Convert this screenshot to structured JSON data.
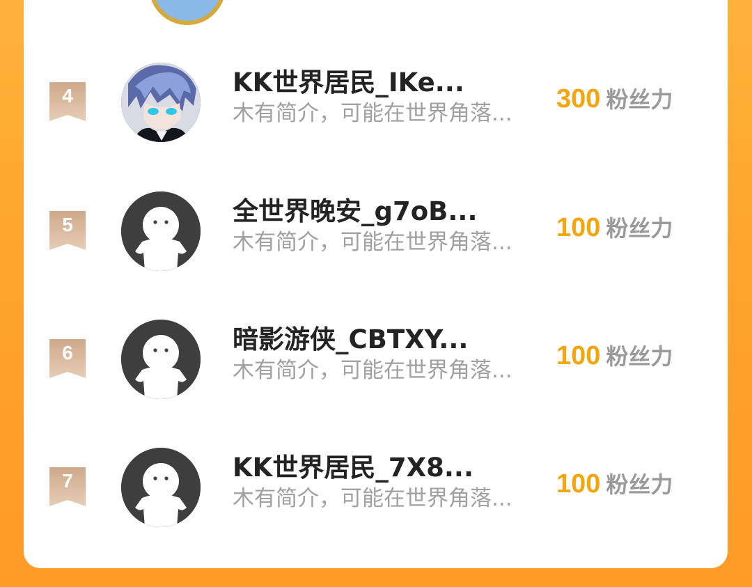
{
  "leaderboard": {
    "rows": [
      {
        "rank": "4",
        "name": "KK世界居民_IKe...",
        "bio": "木有简介，可能在世界角落...",
        "fans": "300",
        "fans_unit": "粉丝力",
        "avatar": "anime-character"
      },
      {
        "rank": "5",
        "name": "全世界晚安_g7oB...",
        "bio": "木有简介，可能在世界角落...",
        "fans": "100",
        "fans_unit": "粉丝力",
        "avatar": "default-user"
      },
      {
        "rank": "6",
        "name": "暗影游侠_CBTXY...",
        "bio": "木有简介，可能在世界角落...",
        "fans": "100",
        "fans_unit": "粉丝力",
        "avatar": "default-user"
      },
      {
        "rank": "7",
        "name": "KK世界居民_7X8...",
        "bio": "木有简介，可能在世界角落...",
        "fans": "100",
        "fans_unit": "粉丝力",
        "avatar": "default-user"
      }
    ]
  },
  "colors": {
    "background": "#ffa42e",
    "rank_badge": "#d8b99c",
    "fans_number": "#f4a60c",
    "name": "#232323",
    "bio": "#a0a0a0",
    "fans_unit": "#9a9a9a"
  }
}
